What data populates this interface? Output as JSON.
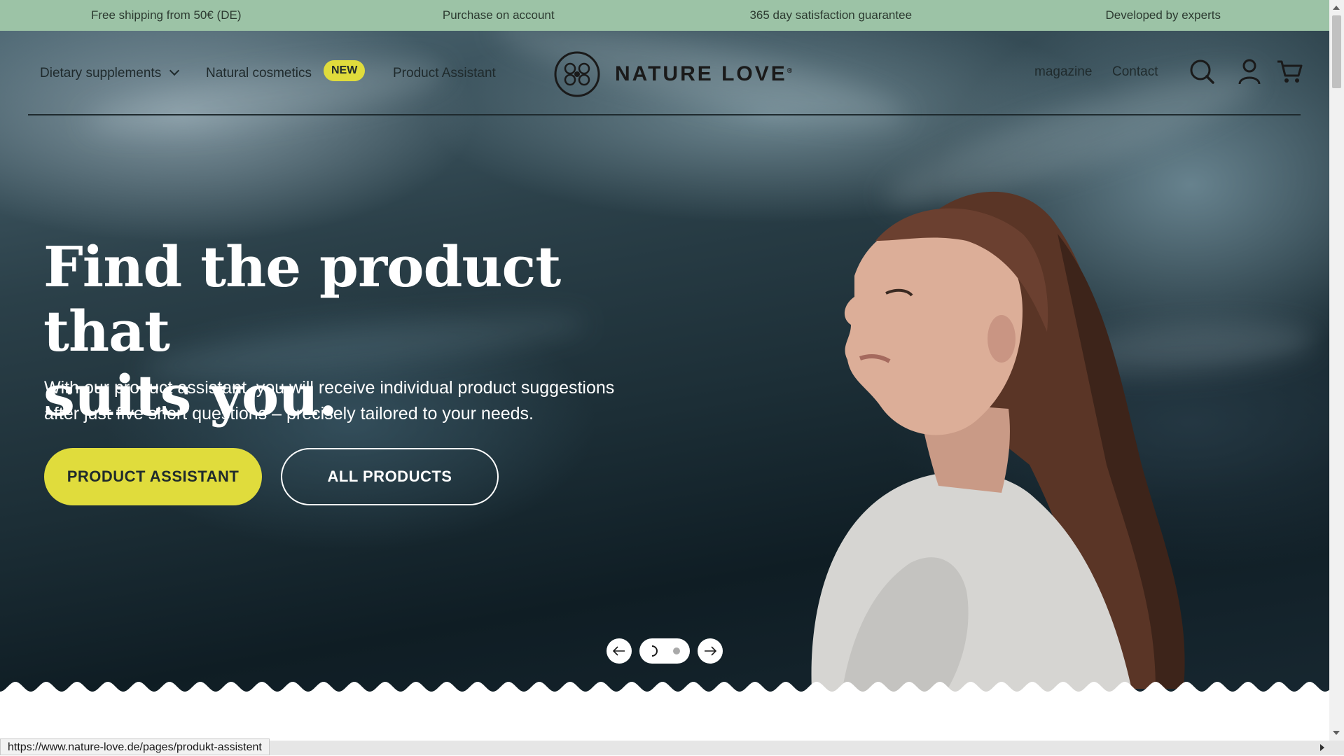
{
  "announcement": {
    "items": [
      "Free shipping from 50€ (DE)",
      "Purchase on account",
      "365 day satisfaction guarantee",
      "Developed by experts"
    ]
  },
  "nav": {
    "dietary_supplements": "Dietary supplements",
    "natural_cosmetics": "Natural cosmetics",
    "new_badge": "NEW",
    "product_assistant": "Product Assistant",
    "logo_text": "NATURE LOVE",
    "logo_mark": "®",
    "magazine": "magazine",
    "contact": "Contact"
  },
  "hero": {
    "headline_line1": "Find the product that",
    "headline_line2": "suits you.",
    "subtext": "With our product assistant, you will receive individual product suggestions after just five short questions – precisely tailored to your needs.",
    "primary_button": "PRODUCT ASSISTANT",
    "secondary_button": "ALL PRODUCTS"
  },
  "status_bar": {
    "url": "https://www.nature-love.de/pages/produkt-assistent"
  },
  "colors": {
    "announcement_bg": "#9cc3a6",
    "accent_yellow": "#e0dc3c",
    "text_dark": "#1f2a2c"
  },
  "icons": {
    "search": "search-icon",
    "account": "user-icon",
    "cart": "cart-icon",
    "prev": "arrow-left-icon",
    "next": "arrow-right-icon"
  }
}
